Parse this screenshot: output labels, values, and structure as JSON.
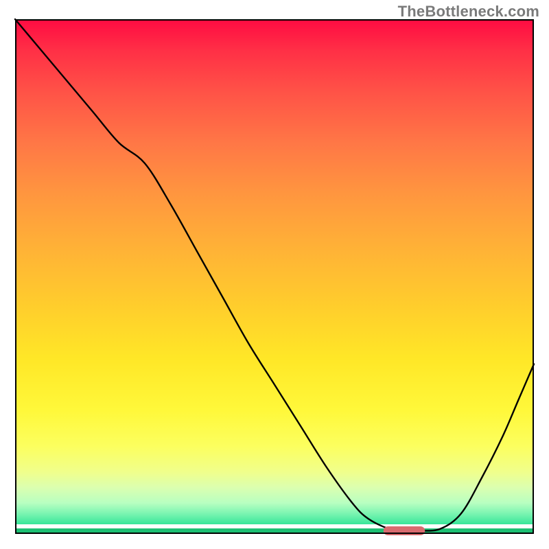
{
  "watermark": "TheBottleneck.com",
  "colors": {
    "gradient_top": "#ff0b42",
    "gradient_bottom": "#0cc97c",
    "curve": "#000000",
    "marker": "#d96b6f",
    "frame": "#000000"
  },
  "chart_data": {
    "type": "line",
    "title": "",
    "xlabel": "",
    "ylabel": "",
    "xlim": [
      0,
      100
    ],
    "ylim": [
      0,
      100
    ],
    "grid": false,
    "legend": false,
    "x": [
      0,
      5,
      10,
      15,
      20,
      25,
      30,
      35,
      40,
      45,
      50,
      55,
      60,
      65,
      68,
      72,
      75,
      78,
      82,
      86,
      90,
      94,
      97,
      100
    ],
    "values": [
      100,
      94,
      88,
      82,
      76,
      72,
      64,
      55,
      46,
      37,
      29,
      21,
      13,
      6,
      3,
      1,
      0.6,
      0.6,
      1,
      4,
      11,
      19,
      26,
      33
    ],
    "marker": {
      "x_start": 71,
      "x_end": 79,
      "y": 0.6,
      "shape": "rounded_bar"
    },
    "annotations": []
  }
}
